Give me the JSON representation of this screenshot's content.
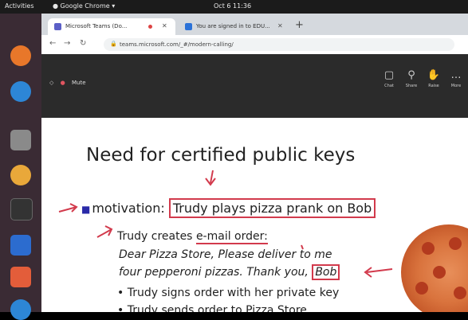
{
  "topbar": {
    "activities": "Activities",
    "app_name": "Google Chrome",
    "clock": "Oct 6  11:36"
  },
  "browser": {
    "tabs": [
      {
        "label": "Microsoft Teams (Do..."
      },
      {
        "label": "You are signed in to EDU..."
      }
    ],
    "new_tab_symbol": "+",
    "url": "teams.microsoft.com/_#/modern-calling/"
  },
  "teams": {
    "meeting_timer": "Mute",
    "controls": [
      {
        "label": "Chat",
        "icon": "chat-icon"
      },
      {
        "label": "Share",
        "icon": "share-icon"
      },
      {
        "label": "Raise",
        "icon": "hand-icon"
      },
      {
        "label": "More",
        "icon": "more-icon"
      }
    ]
  },
  "slide": {
    "title": "Need for certified public keys",
    "bullet_lead": "motivation:",
    "bullet_highlight": "Trudy plays pizza prank on Bob",
    "sub1_pre": "Trudy creates ",
    "sub1_underlined": "e-mail order:",
    "order_line1": "Dear Pizza Store, Please deliver to me",
    "order_line2": "four pepperoni pizzas. Thank you,",
    "order_signature": "Bob",
    "sub2": "Trudy signs order with her private key",
    "sub3": "Trudy sends order to Pizza Store"
  },
  "colors": {
    "annotation": "#d23a4c",
    "bullet": "#2a2aa8",
    "teams_bar": "#2b2b2b"
  }
}
